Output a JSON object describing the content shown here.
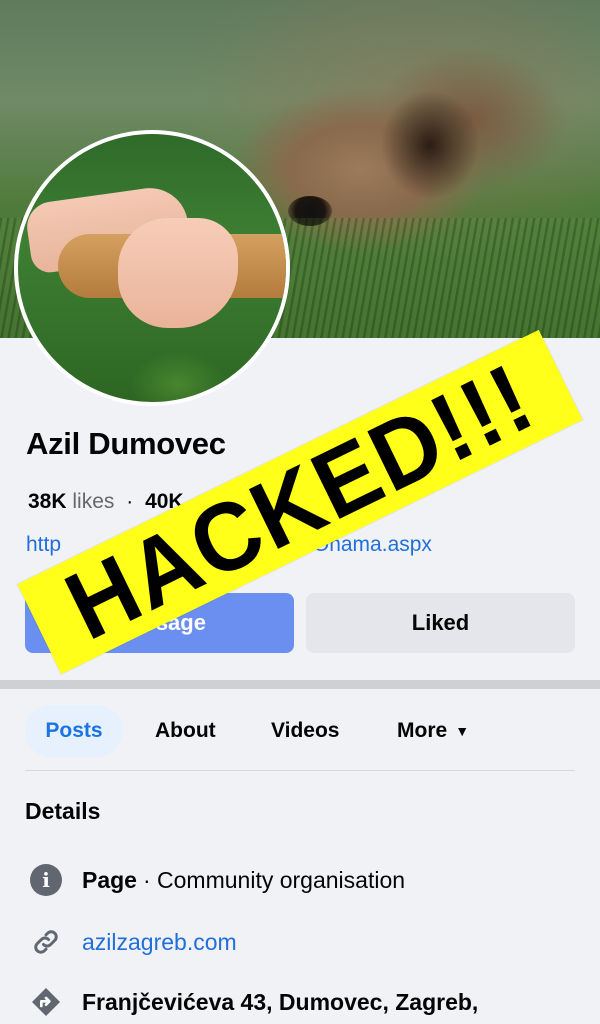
{
  "cover": {
    "subject": "dog lying in grass"
  },
  "avatar": {
    "subject": "hand holding a dog paw"
  },
  "profile": {
    "name": "Azil Dumovec",
    "likes_count": "38K",
    "likes_label": "likes",
    "separator": "·",
    "followers_partial": "40K",
    "url_start": "http",
    "url_end": "/Onama.aspx"
  },
  "buttons": {
    "message": "Message",
    "liked": "Liked"
  },
  "tabs": [
    {
      "label": "Posts",
      "active": true
    },
    {
      "label": "About"
    },
    {
      "label": "Videos"
    },
    {
      "label": "More"
    }
  ],
  "details": {
    "title": "Details",
    "page_label": "Page",
    "page_category": "· Community organisation",
    "website": "azilzagreb.com",
    "address": "Franjčevićeva 43, Dumovec, Zagreb,"
  },
  "overlay": {
    "text": "HACKED!!!",
    "color": "#ffff1a"
  },
  "colors": {
    "link": "#216fdb",
    "active_tab": "#1b74e4",
    "message_button": "#6a8ff0"
  }
}
